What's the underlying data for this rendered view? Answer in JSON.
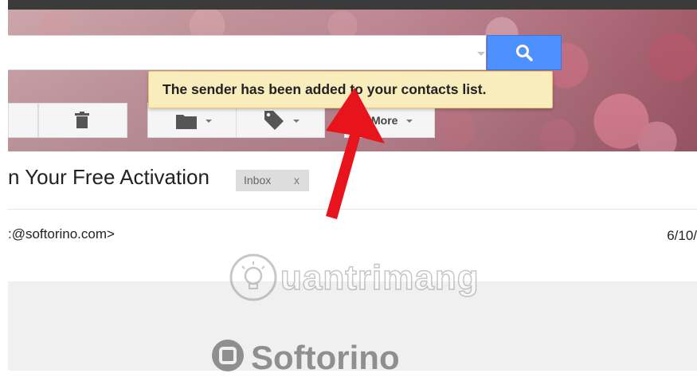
{
  "notification": {
    "message": "The sender has been added to your contacts list."
  },
  "search": {
    "value": "",
    "placeholder": ""
  },
  "toolbar": {
    "more_label": "More"
  },
  "message": {
    "subject": "n Your Free Activation",
    "label": "Inbox",
    "label_remove": "x",
    "sender": ":@softorino.com>",
    "date": "6/10/"
  },
  "email_body": {
    "brand": "Softorino"
  },
  "watermark": {
    "text": "uantrimang"
  },
  "icons": {
    "search": "search-icon",
    "delete": "trash-icon",
    "move": "folder-icon",
    "labels": "tag-icon",
    "dropdown": "chevron-down-icon"
  },
  "colors": {
    "search_button": "#4d90fe",
    "notification_bg": "#f9edbe",
    "arrow": "#e8141c",
    "label_chip": "#dddddd"
  }
}
